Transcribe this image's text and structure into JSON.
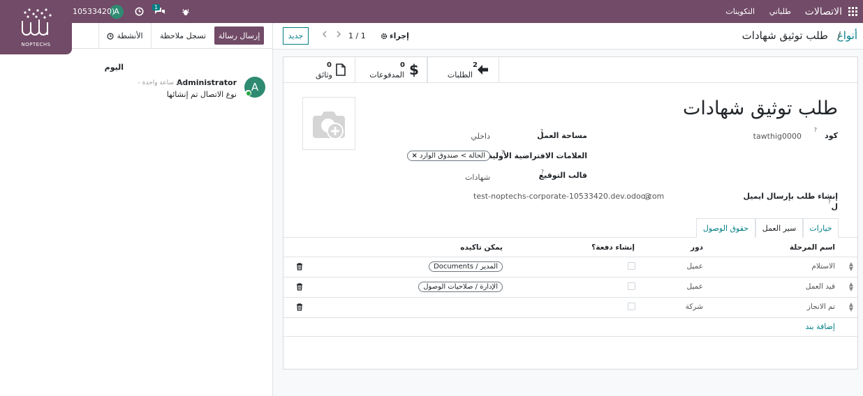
{
  "brand": {
    "logo_text": "NOPTECHS"
  },
  "navbar": {
    "app_name": "الاتصالات",
    "menu_items": [
      "طلباتي",
      "التكوينات"
    ],
    "company_id": "10533420)",
    "avatar_letter": "A",
    "message_count": "1"
  },
  "chatter": {
    "send_message": "إرسال رسالة",
    "log_note": "تسجل ملاحظة",
    "activities": "الأنشطة",
    "today": "اليوم",
    "message": {
      "author": "Administrator",
      "time": "- منذ ساعة واحدة",
      "body": "نوع الاتصال تم إنشائها",
      "avatar": "A"
    }
  },
  "control_panel": {
    "breadcrumb_parent": "أنواع",
    "breadcrumb_sep": "/",
    "record_title": "طلب توثيق شهادات",
    "action_label": "إجراء",
    "pager": "1 / 1",
    "new_button": "جديد"
  },
  "smart_buttons": [
    {
      "count": "2",
      "label": "الطلبات",
      "icon": "arrow-left-icon"
    },
    {
      "count": "0",
      "label": "المدفوعات",
      "icon": "dollar-icon"
    },
    {
      "count": "0",
      "label": "وثائق",
      "icon": "document-icon"
    }
  ],
  "form": {
    "title": "طلب توثيق شهادات",
    "code_label": "كود",
    "code_value": "tawthig0000",
    "workspace_label": "مساحة العمل",
    "workspace_value": "داخلي",
    "default_tags_label": "العلامات الافتراضية الأولية",
    "default_tag": "الحالة > صندوق الوارد",
    "signature_label": "قالب التوقيع",
    "signature_value": "شهادات",
    "email_label_1": "إنشاء طلب بإرسال ايميل",
    "email_label_2": "ل",
    "email_value": "test-noptechs-corporate-10533420.dev.odoo.com",
    "email_at": "@",
    "help_mark": "?"
  },
  "tabs": [
    "خيارات",
    "سير العمل",
    "حقوق الوصول"
  ],
  "workflow_table": {
    "headers": [
      "اسم المرحلة",
      "دور",
      "إنشاء دفعة؟",
      "يمكن تاكيده"
    ],
    "rows": [
      {
        "stage": "الاستلام",
        "role": "عميل",
        "payment": false,
        "confirm": "Documents / المدير"
      },
      {
        "stage": "قيد العمل",
        "role": "عميل",
        "payment": false,
        "confirm": "الإدارة / صلاحيات الوصول"
      },
      {
        "stage": "تم الانجاز",
        "role": "شركة",
        "payment": false,
        "confirm": ""
      }
    ],
    "add_line": "إضافة بند"
  }
}
